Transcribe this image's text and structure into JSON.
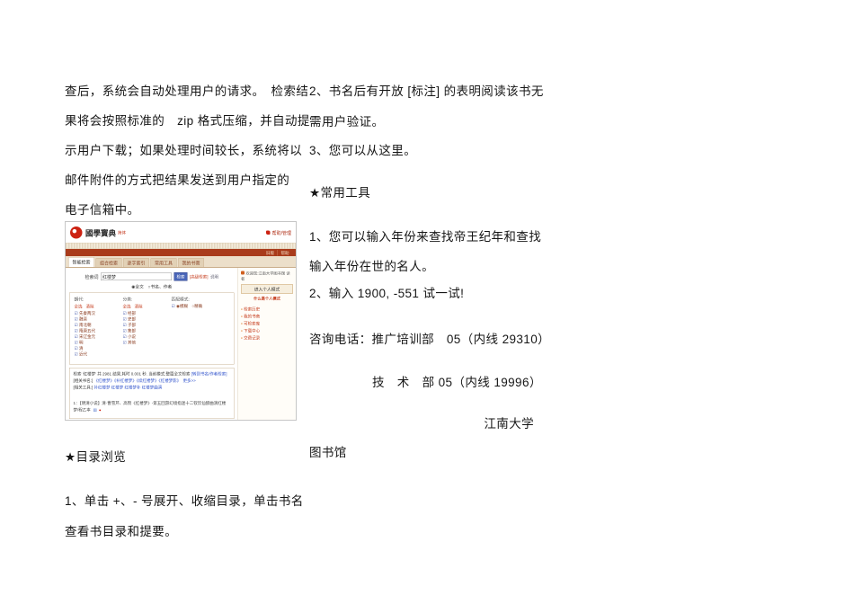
{
  "document": {
    "left_column": {
      "para_lines": [
        "查后，系统会自动处理用户的请求。　检索结",
        "果将会按照标准的　zip 格式压缩，并自动提",
        "示用户下载；如果处理时间较长，系统将以",
        "邮件附件的方式把结果发送到用户指定的",
        "电子信箱中。"
      ],
      "catalog_title": "★目录浏览",
      "catalog_lines": [
        "1、单击 +、- 号展开、收缩目录，单击书名",
        "查看书目录和提要。"
      ]
    },
    "right_column": {
      "note_lines": [
        "2、书名后有开放 [标注] 的表明阅读该书无",
        "需用户验证。",
        "3、您可以从这里。"
      ],
      "tools_title": "★常用工具",
      "tools_lines": [
        "1、您可以输入年份来查找帝王纪年和查找",
        "输入年份在世的名人。",
        "2、输入 1900, -551 试一试!"
      ],
      "contact_line1": "咨询电话：推广培训部　05（内线 29310）",
      "contact_line2": "技　术　部 05（内线 19996）",
      "signature_org": "江南大学",
      "signature_dept": "图书馆"
    }
  },
  "screenshot": {
    "header": {
      "title": "國學寶典",
      "subtitle": "简体",
      "admin_link": "帮助/管理"
    },
    "redbar": {
      "links": [
        "旧版",
        "帮助"
      ]
    },
    "tabs": [
      "智能检索",
      "组合检索",
      "逐字索引",
      "常用工具",
      "我的书斋"
    ],
    "search": {
      "label": "检索词",
      "value": "红楼梦",
      "button": "检索",
      "advanced_link": "[高级检索]",
      "help": "说明",
      "scope": "◉全文　○书名、作者"
    },
    "filters": {
      "dynasty_header": "朝代:",
      "category_header": "分类:",
      "mode_header": "匹配模式:",
      "select_all": "全选",
      "clear": "清除",
      "dynasties": [
        "先秦两汉",
        "魏晋",
        "南北朝",
        "隋唐五代",
        "宋辽金元",
        "明",
        "清",
        "近代"
      ],
      "categories": [
        "经部",
        "史部",
        "子部",
        "集部",
        "小说",
        "其他"
      ],
      "mode_options": "◉模糊　○精确"
    },
    "results": {
      "summary": "检索 '红楼梦' 共 2981 结果,耗时 0.001 秒. 当前模式:整篇全文检索",
      "summary_link": "[转到书名/作者检索]",
      "related_books_label": "[相关书名:]",
      "related_books": "《红楼梦》《补红楼梦》《续红楼梦》《红楼梦影》　更多>>",
      "related_tools_label": "[相关工具:]",
      "related_tools": "补红楼梦 红楼梦 红楼梦补 红楼梦曲演",
      "item": "1：【明清小说】清·曹雪芹、高鹗《红楼梦》-第五回游幻境指迷十二钗饮仙醪曲演红楼梦/程乙本"
    },
    "sidebar": {
      "welcome": "欢迎您:江南大学图书馆 读者",
      "mode_button": "进入个人模式",
      "mode_link": "什么是个人模式",
      "links": [
        "检索历史",
        "我的书斋",
        "可检索库",
        "下载中心",
        "交费记录"
      ]
    }
  }
}
